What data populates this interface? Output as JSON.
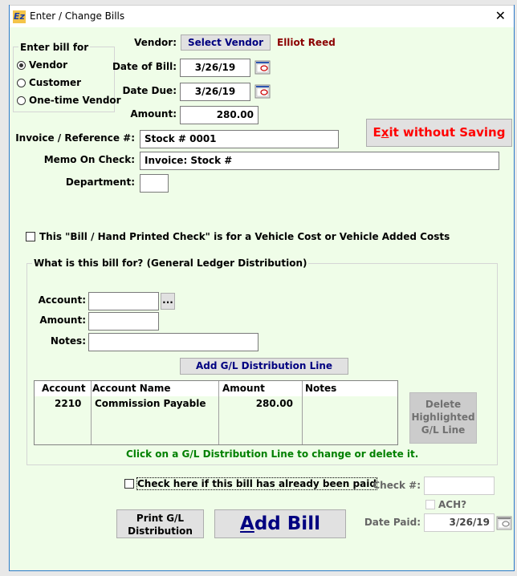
{
  "window": {
    "title": "Enter / Change Bills",
    "app_icon": "app-logo-icon",
    "close_glyph": "✕",
    "background_color": "#effde8"
  },
  "enter_bill_for": {
    "legend": "Enter bill for",
    "options": [
      {
        "label": "Vendor",
        "selected": true
      },
      {
        "label": "Customer",
        "selected": false
      },
      {
        "label": "One-time Vendor",
        "selected": false
      }
    ]
  },
  "header": {
    "vendor_label": "Vendor:",
    "select_vendor_button": "Select Vendor",
    "vendor_name": "Elliot Reed",
    "vendor_name_color": "#8b0000",
    "date_of_bill_label": "Date of Bill:",
    "date_of_bill": "3/26/19",
    "date_due_label": "Date Due:",
    "date_due": "3/26/19",
    "amount_label": "Amount:",
    "amount": "280.00",
    "invoice_label": "Invoice / Reference #:",
    "invoice": "Stock # 0001",
    "memo_label": "Memo On Check:",
    "memo": "Invoice: Stock #",
    "department_label": "Department:",
    "department": "",
    "exit_button": {
      "pre": "E",
      "underlined": "x",
      "post": "it without Saving",
      "color": "#ff0000"
    }
  },
  "vehicle_cost": {
    "label": "This \"Bill / Hand Printed Check\" is for a Vehicle Cost or Vehicle Added Costs",
    "checked": false
  },
  "gl_distribution": {
    "legend": "What is this bill for? (General Ledger Distribution)",
    "account_label": "Account:",
    "account": "",
    "browse_button": "...",
    "amount_label": "Amount:",
    "amount": "",
    "notes_label": "Notes:",
    "notes": "",
    "add_line_button": "Add G/L Distribution Line",
    "columns": [
      "Account",
      "Account Name",
      "Amount",
      "Notes"
    ],
    "rows": [
      {
        "account": "2210",
        "account_name": "Commission Payable",
        "amount": "280.00",
        "notes": ""
      }
    ],
    "hint": "Click on a G/L Distribution Line to change or delete it.",
    "hint_color": "#008000",
    "delete_button": "Delete Highlighted G/L Line"
  },
  "payment": {
    "already_paid_label": "Check here if this bill has already been paid",
    "already_paid_checked": false,
    "check_no_label": "Check #:",
    "check_no": "",
    "ach_label": "ACH?",
    "ach_checked": false,
    "date_paid_label": "Date Paid:",
    "date_paid": "3/26/19"
  },
  "footer": {
    "print_button": "Print G/L Distribution",
    "print_line1": "Print G/L",
    "print_line2": "Distribution",
    "add_bill_button": {
      "underlined": "A",
      "rest": "dd Bill"
    },
    "add_bill_color": "#000080"
  }
}
